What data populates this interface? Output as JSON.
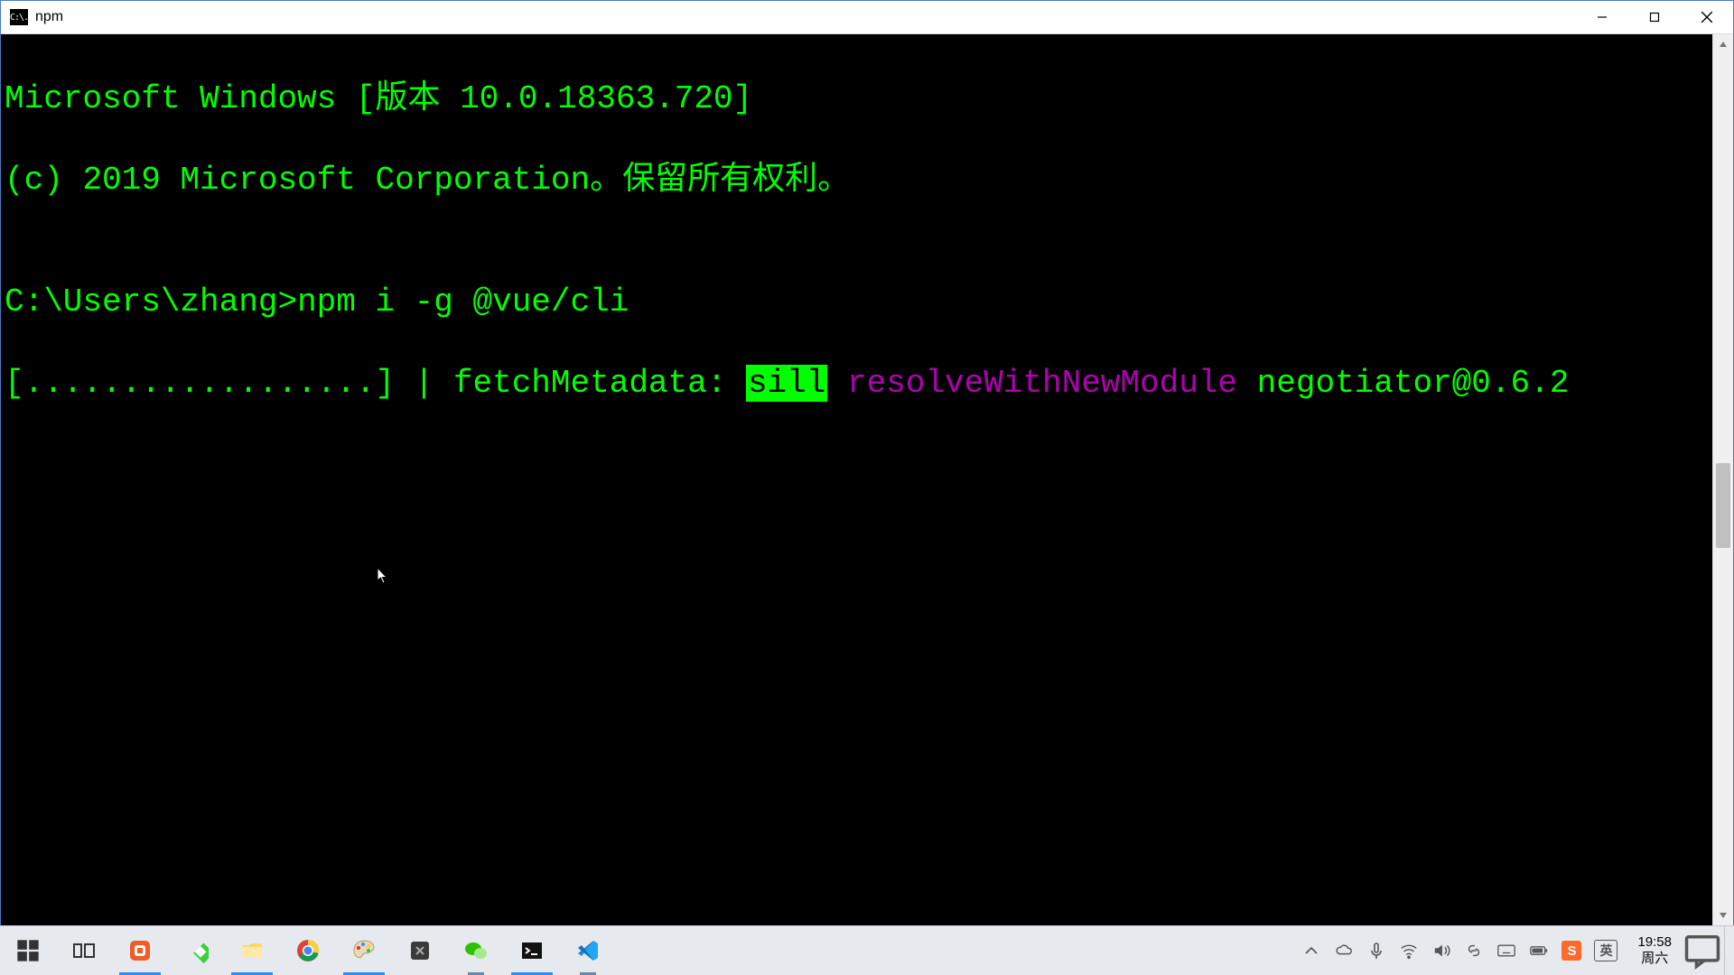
{
  "window": {
    "title": "npm",
    "icon_glyph": "C:\\."
  },
  "terminal": {
    "line1": "Microsoft Windows [版本 10.0.18363.720]",
    "line2": "(c) 2019 Microsoft Corporation。保留所有权利。",
    "blank": "",
    "prompt": "C:\\Users\\zhang>",
    "command": "npm i -g @vue/cli",
    "progress_prefix": "[..................] | fetchMetadata: ",
    "sill": "sill",
    "resolve": " resolveWithNewModule",
    "pkg": " negotiator@0.6.2"
  },
  "ime_label": "英",
  "taskbar": {
    "clock_time": "19:58",
    "clock_day": "周六"
  }
}
